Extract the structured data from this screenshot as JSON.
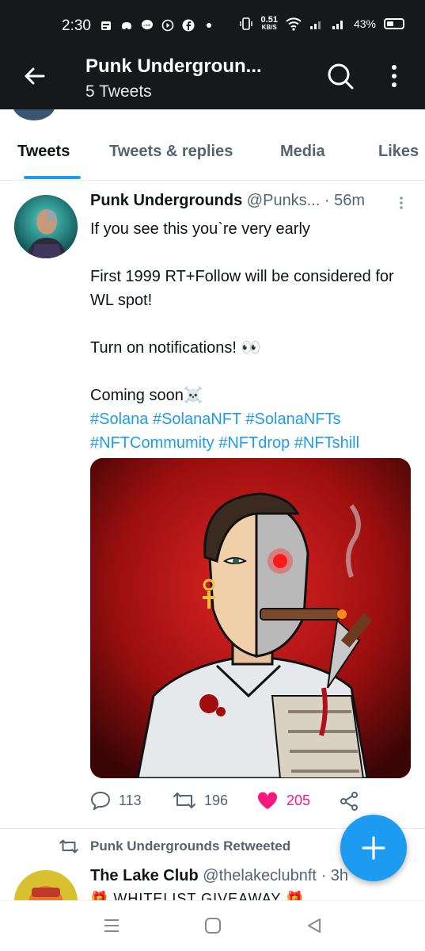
{
  "status_bar": {
    "time": "2:30",
    "net_speed_value": "0.51",
    "net_speed_unit": "KB/S",
    "battery": "43%"
  },
  "header": {
    "title": "Punk Undergroun...",
    "subtitle": "5 Tweets"
  },
  "tabs": [
    {
      "label": "Tweets",
      "active": true
    },
    {
      "label": "Tweets & replies",
      "active": false
    },
    {
      "label": "Media",
      "active": false
    },
    {
      "label": "Likes",
      "active": false
    }
  ],
  "tweet": {
    "author_name": "Punk Undergrounds",
    "author_handle": "@Punks...",
    "time": "· 56m",
    "lines": [
      "If you see this you`re very early",
      "First 1999 RT+Follow will be considered for WL spot!",
      "Turn on notifications! 👀",
      "Coming soon☠️"
    ],
    "hashtags_line1": "#Solana #SolanaNFT #SolanaNFTs",
    "hashtags_line2": "#NFTCommumity #NFTdrop #NFTshill",
    "replies": "113",
    "retweets": "196",
    "likes": "205"
  },
  "next_tweet": {
    "retweeted_by": "Punk Undergrounds Retweeted",
    "author_name": "The Lake Club",
    "author_handle": "@thelakeclubnft",
    "time": "· 3h",
    "first_line": "🎁 WHITELIST GIVEAWAY 🎁"
  },
  "colors": {
    "accent": "#1d9bf0",
    "like": "#f91880",
    "header_bg": "#17181c"
  }
}
